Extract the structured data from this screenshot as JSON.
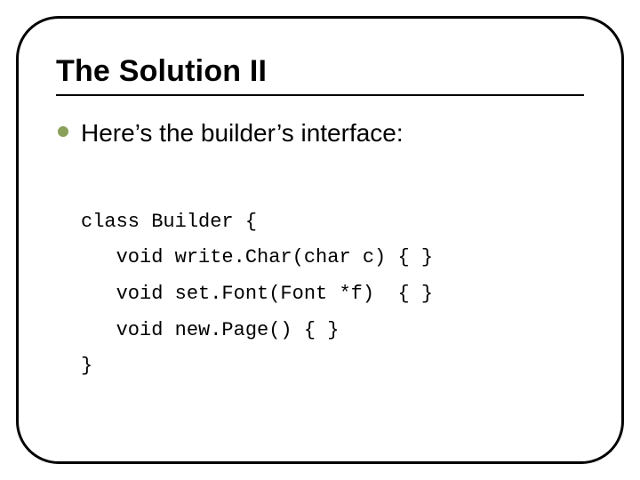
{
  "slide": {
    "title": "The Solution II",
    "bullet": "Here’s the builder’s interface:",
    "code": {
      "l1": "class Builder {",
      "l2": "   void write.Char(char c) { }",
      "l3": "   void set.Font(Font *f)  { }",
      "l4": "   void new.Page() { }",
      "l5": "}"
    }
  }
}
